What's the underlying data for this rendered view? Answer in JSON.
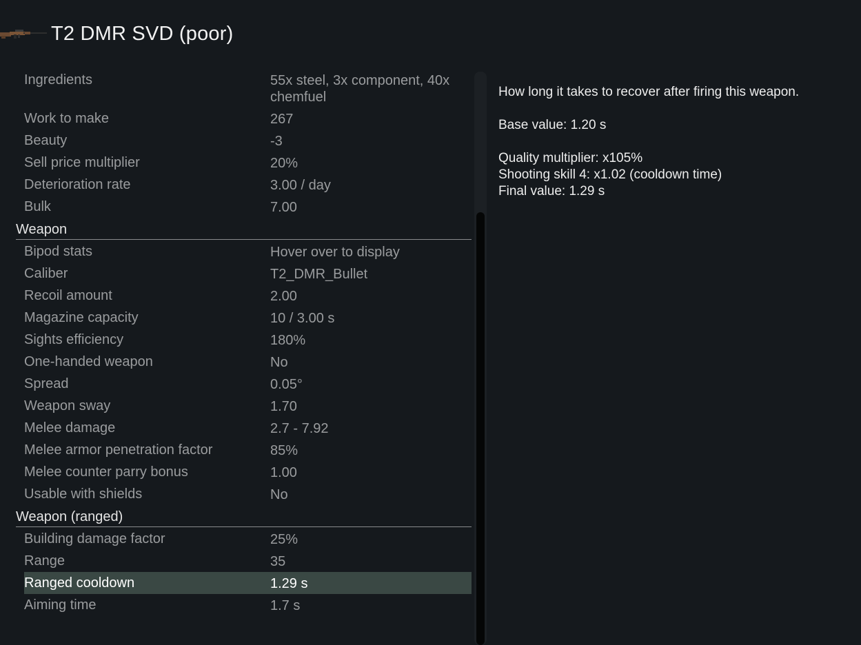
{
  "header": {
    "icon": "rifle-icon",
    "title": "T2 DMR SVD (poor)"
  },
  "general": [
    {
      "label": "Ingredients",
      "value": "55x steel, 3x component, 40x chemfuel"
    },
    {
      "label": "Work to make",
      "value": "267"
    },
    {
      "label": "Beauty",
      "value": "-3"
    },
    {
      "label": "Sell price multiplier",
      "value": "20%"
    },
    {
      "label": "Deterioration rate",
      "value": "3.00 / day"
    },
    {
      "label": "Bulk",
      "value": "7.00"
    }
  ],
  "weapon": {
    "title": "Weapon",
    "rows": [
      {
        "label": "Bipod stats",
        "value": "Hover over to display"
      },
      {
        "label": "Caliber",
        "value": "T2_DMR_Bullet"
      },
      {
        "label": "Recoil amount",
        "value": "2.00"
      },
      {
        "label": "Magazine capacity",
        "value": "10 / 3.00 s"
      },
      {
        "label": "Sights efficiency",
        "value": "180%"
      },
      {
        "label": "One-handed weapon",
        "value": "No"
      },
      {
        "label": "Spread",
        "value": "0.05°"
      },
      {
        "label": "Weapon sway",
        "value": "1.70"
      },
      {
        "label": "Melee damage",
        "value": "2.7 - 7.92"
      },
      {
        "label": "Melee armor penetration factor",
        "value": "85%"
      },
      {
        "label": "Melee counter parry bonus",
        "value": "1.00"
      },
      {
        "label": "Usable with shields",
        "value": "No"
      }
    ]
  },
  "weapon_ranged": {
    "title": "Weapon (ranged)",
    "rows": [
      {
        "label": "Building damage factor",
        "value": "25%"
      },
      {
        "label": "Range",
        "value": "35"
      },
      {
        "label": "Ranged cooldown",
        "value": "1.29 s"
      },
      {
        "label": "Aiming time",
        "value": "1.7 s"
      }
    ]
  },
  "tooltip": {
    "description": "How long it takes to recover after firing this weapon.",
    "base_value": "Base value: 1.20 s",
    "quality_multiplier": "Quality multiplier: x105%",
    "shooting_skill": "Shooting skill 4: x1.02 (cooldown time)",
    "final_value": "Final value: 1.29 s"
  }
}
